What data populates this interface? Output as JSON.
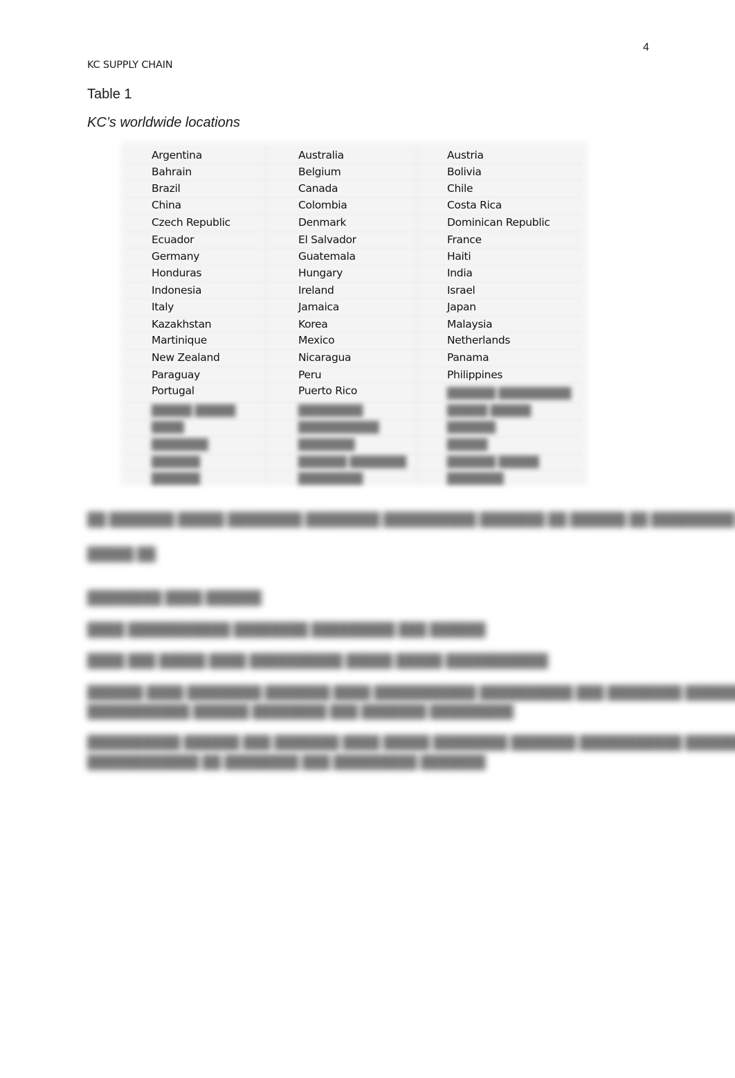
{
  "header": {
    "page_number": "4",
    "running_head": "KC SUPPLY CHAIN"
  },
  "table": {
    "label": "Table 1",
    "caption": "KC’s worldwide locations",
    "rows": [
      [
        "Argentina",
        "Australia",
        "Austria"
      ],
      [
        "Bahrain",
        "Belgium",
        "Bolivia"
      ],
      [
        "Brazil",
        "Canada",
        "Chile"
      ],
      [
        "China",
        "Colombia",
        "Costa Rica"
      ],
      [
        "Czech Republic",
        "Denmark",
        "Dominican Republic"
      ],
      [
        "Ecuador",
        "El Salvador",
        "France"
      ],
      [
        "Germany",
        "Guatemala",
        "Haiti"
      ],
      [
        "Honduras",
        "Hungary",
        "India"
      ],
      [
        "Indonesia",
        "Ireland",
        "Israel"
      ],
      [
        "Italy",
        "Jamaica",
        "Japan"
      ],
      [
        "Kazakhstan",
        "Korea",
        "Malaysia"
      ],
      [
        "Martinique",
        "Mexico",
        "Netherlands"
      ],
      [
        "New Zealand",
        "Nicaragua",
        "Panama"
      ],
      [
        "Paraguay",
        "Peru",
        "Philippines"
      ],
      [
        "Portugal",
        "Puerto Rico",
        "██████ █████████"
      ],
      [
        "█████ █████",
        "████████",
        "█████ █████"
      ],
      [
        "████",
        "██████████",
        "██████"
      ],
      [
        "███████",
        "███████",
        "█████"
      ],
      [
        "██████",
        "██████ ███████",
        "██████ █████"
      ],
      [
        "██████",
        "████████",
        "███████"
      ]
    ],
    "visible_row_count": 15
  },
  "blurred_body": {
    "lines": [
      "██ ███████ █████ ████████ ████████ ██████████ ███████ ██ ██████ ██ █████████ ███████",
      "█████ ██",
      "████████ ████   ██████",
      "████ ███████████ ████████   █████████ ███ ██████",
      "████ ███ █████ ████   ██████████ █████ █████ ███████████",
      "██████ ████   ████████ ███████ ████ ███████████ ██████████ ███ ████████ ███████████",
      "███████████ ██████ ████████ ███ ███████ █████████",
      "██████████ ██████ ███ ███████ ████ █████   ████████ ███████ ███████████ ██████████",
      "████████████ ██ ████████ ███ █████████ ███████"
    ]
  }
}
